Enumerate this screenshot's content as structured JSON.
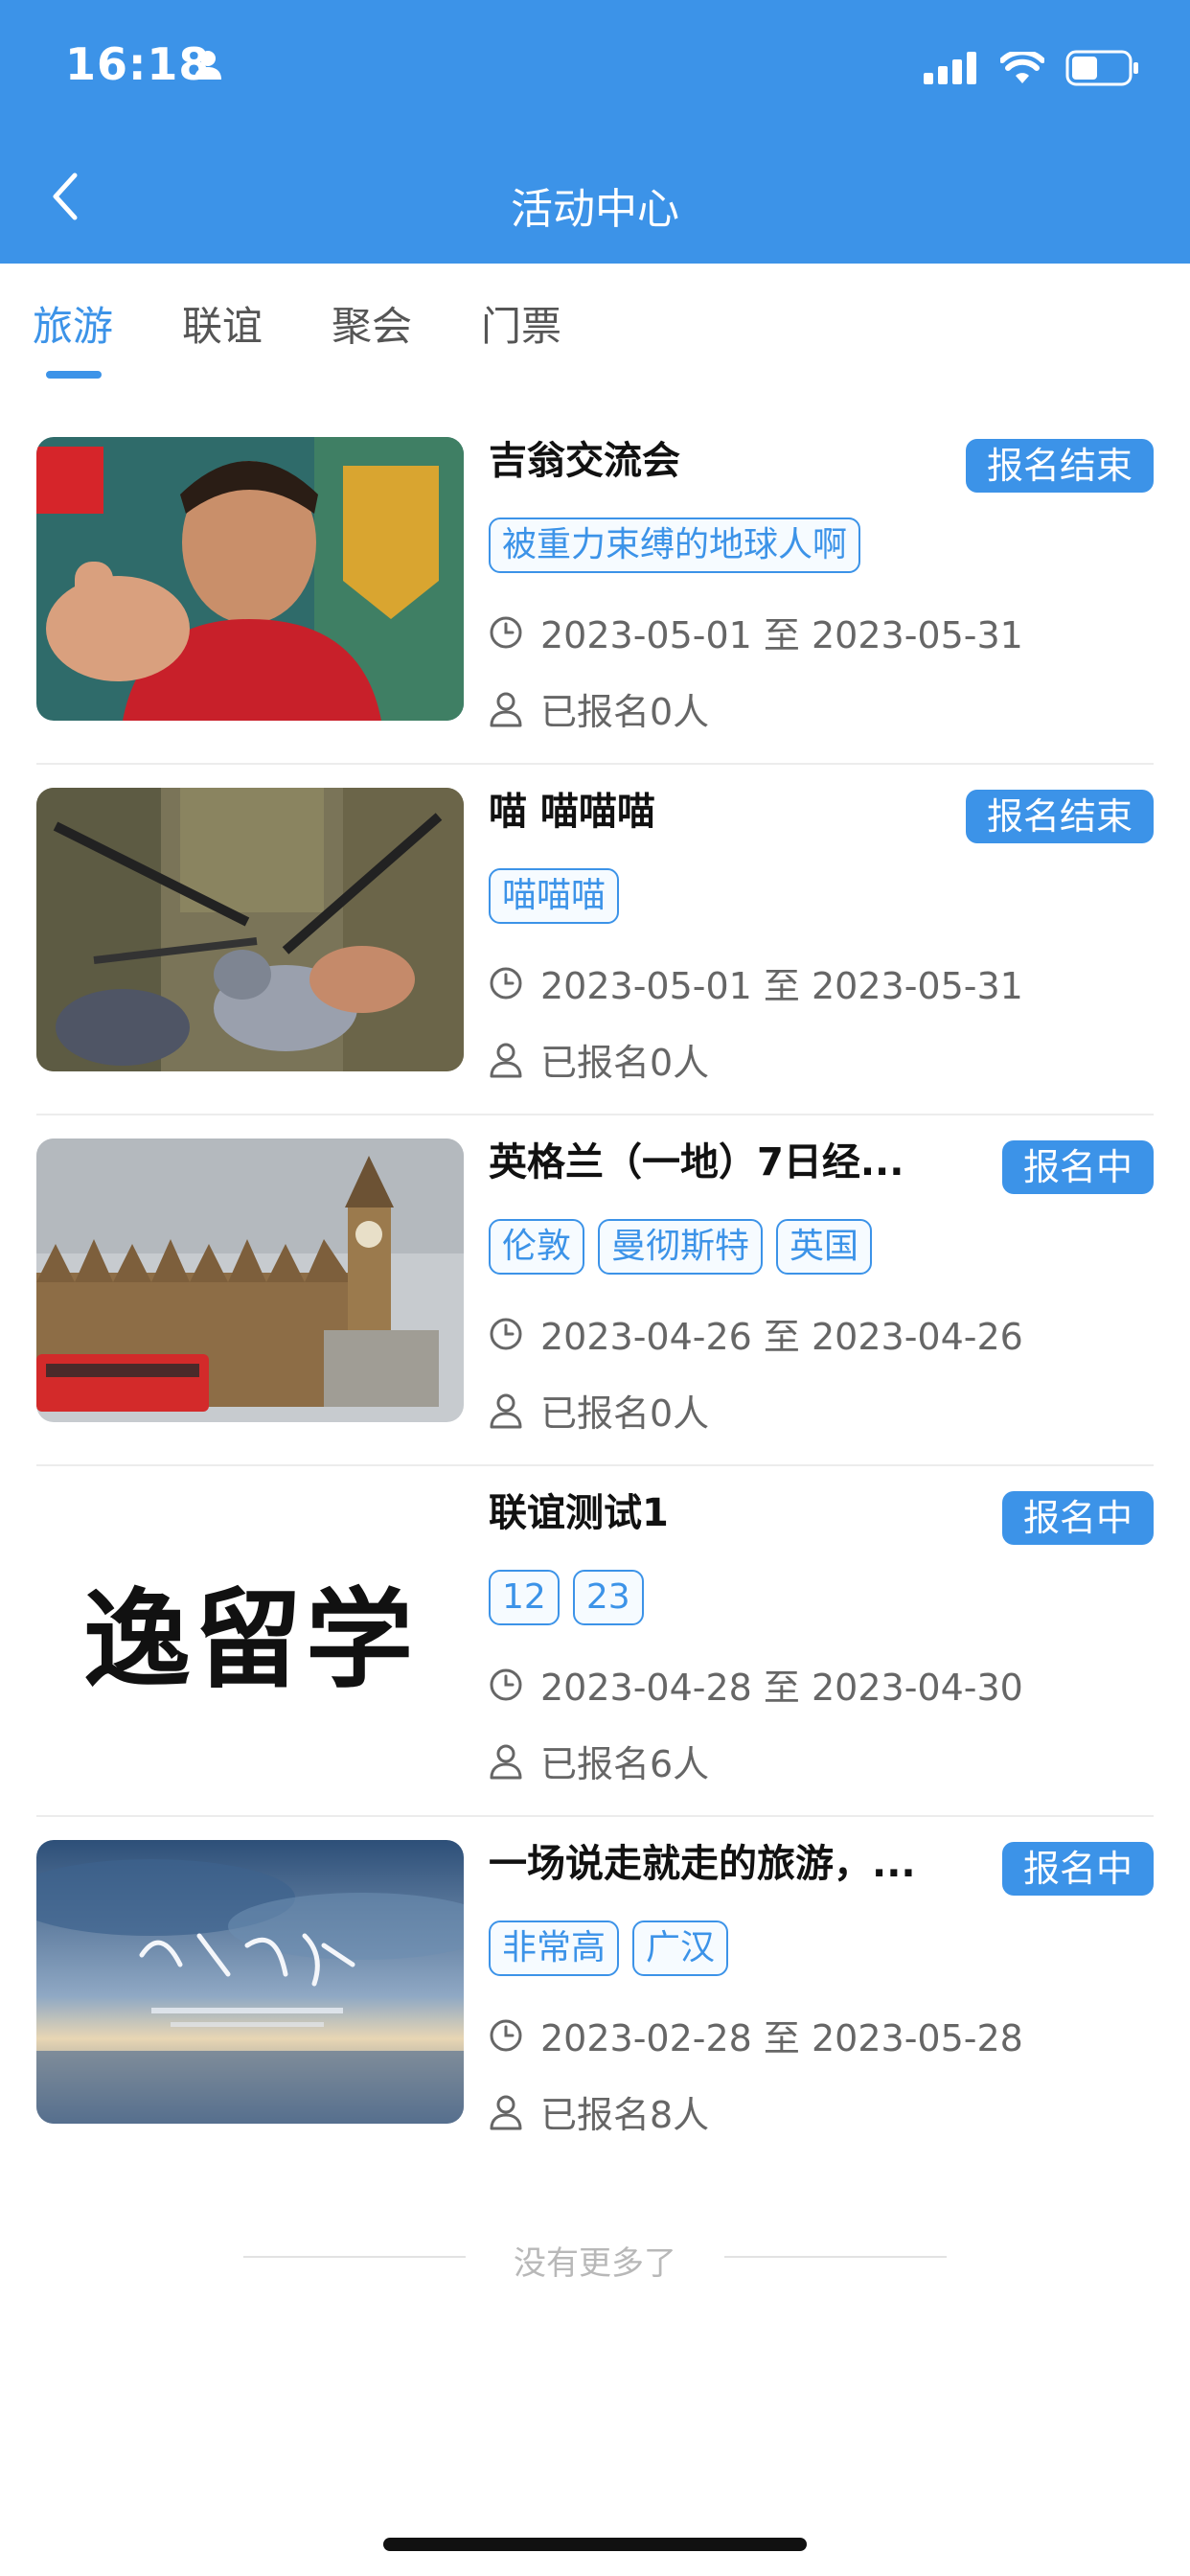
{
  "status_bar": {
    "time": "16:18"
  },
  "nav": {
    "title": "活动中心"
  },
  "tabs": [
    {
      "label": "旅游",
      "active": true
    },
    {
      "label": "联谊",
      "active": false
    },
    {
      "label": "聚会",
      "active": false
    },
    {
      "label": "门票",
      "active": false
    }
  ],
  "events": [
    {
      "title": "吉翁交流会",
      "status": "报名结束",
      "tags": [
        "被重力束缚的地球人啊"
      ],
      "date_range": "2023-05-01 至 2023-05-31",
      "registered": "已报名0人"
    },
    {
      "title": "喵 喵喵喵",
      "status": "报名结束",
      "tags": [
        "喵喵喵"
      ],
      "date_range": "2023-05-01 至 2023-05-31",
      "registered": "已报名0人"
    },
    {
      "title": "英格兰（一地）7日经...",
      "status": "报名中",
      "tags": [
        "伦敦",
        "曼彻斯特",
        "英国"
      ],
      "date_range": "2023-04-26 至 2023-04-26",
      "registered": "已报名0人"
    },
    {
      "title": "联谊测试1",
      "status": "报名中",
      "tags": [
        "12",
        "23"
      ],
      "date_range": "2023-04-28 至 2023-04-30",
      "registered": "已报名6人",
      "thumb_text": "逸留学"
    },
    {
      "title": "一场说走就走的旅游，...",
      "status": "报名中",
      "tags": [
        "非常高",
        "广汉"
      ],
      "date_range": "2023-02-28 至 2023-05-28",
      "registered": "已报名8人"
    }
  ],
  "footer": {
    "text": "没有更多了"
  },
  "colors": {
    "accent": "#3c93e8",
    "text_secondary": "#666666"
  }
}
